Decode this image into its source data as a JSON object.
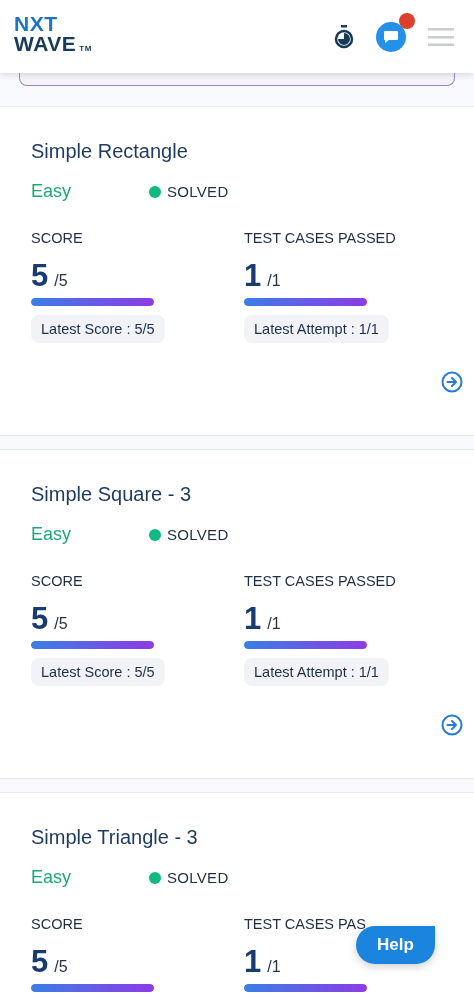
{
  "header": {
    "logo": {
      "line_1": "NXT",
      "line_2": "WAVE",
      "mark": "TM"
    },
    "notification": true
  },
  "problems": [
    {
      "title": "Simple Rectangle",
      "difficulty": "Easy",
      "status": {
        "label": "SOLVED",
        "color": "#10b981"
      },
      "score": {
        "label": "SCORE",
        "value": "5",
        "total": "/5",
        "level": 1,
        "latest": "Latest Score : 5/5"
      },
      "tests": {
        "label": "TEST CASES PASSED",
        "value": "1",
        "total": "/1",
        "level": 1,
        "latest": "Latest Attempt : 1/1"
      }
    },
    {
      "title": "Simple Square - 3",
      "difficulty": "Easy",
      "status": {
        "label": "SOLVED",
        "color": "#10b981"
      },
      "score": {
        "label": "SCORE",
        "value": "5",
        "total": "/5",
        "level": 1,
        "latest": "Latest Score : 5/5"
      },
      "tests": {
        "label": "TEST CASES PASSED",
        "value": "1",
        "total": "/1",
        "level": 1,
        "latest": "Latest Attempt : 1/1"
      }
    },
    {
      "title": "Simple Triangle - 3",
      "difficulty": "Easy",
      "status": {
        "label": "SOLVED",
        "color": "#10b981"
      },
      "score": {
        "label": "SCORE",
        "value": "5",
        "total": "/5",
        "level": 1
      },
      "tests": {
        "label": "TEST CASES PAS",
        "value": "1",
        "total": "/1",
        "level": 1
      }
    }
  ],
  "help_button": "Help"
}
